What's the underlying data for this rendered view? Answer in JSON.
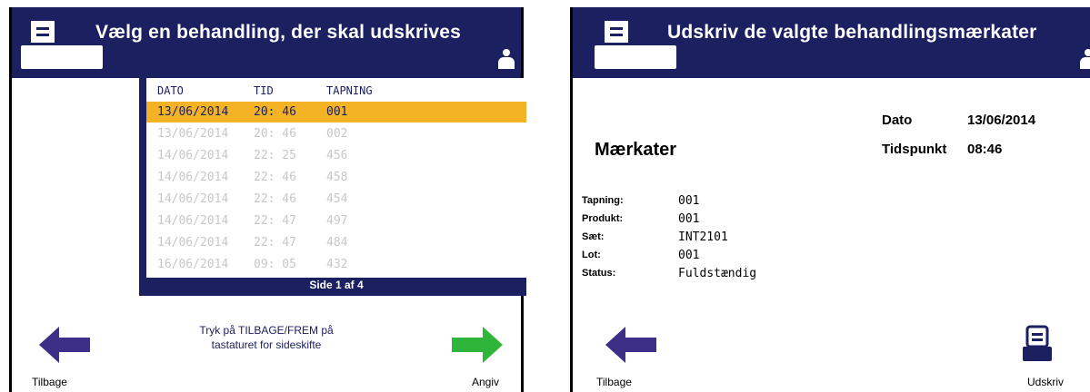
{
  "left": {
    "title": "Vælg en behandling, der skal udskrives",
    "columns": [
      "DATO",
      "TID",
      "TAPNING"
    ],
    "rows": [
      {
        "date": "13/06/2014",
        "time": "20: 46",
        "tap": "001",
        "selected": true
      },
      {
        "date": "13/06/2014",
        "time": "20: 46",
        "tap": "002",
        "selected": false
      },
      {
        "date": "14/06/2014",
        "time": "22: 25",
        "tap": "456",
        "selected": false
      },
      {
        "date": "14/06/2014",
        "time": "22: 46",
        "tap": "458",
        "selected": false
      },
      {
        "date": "14/06/2014",
        "time": "22: 46",
        "tap": "454",
        "selected": false
      },
      {
        "date": "14/06/2014",
        "time": "22: 47",
        "tap": "497",
        "selected": false
      },
      {
        "date": "14/06/2014",
        "time": "22: 47",
        "tap": "484",
        "selected": false
      },
      {
        "date": "16/06/2014",
        "time": "09: 05",
        "tap": "432",
        "selected": false
      }
    ],
    "page_indicator": "Side 1 af 4",
    "hint_line1": "Tryk på TILBAGE/FREM på",
    "hint_line2": "tastaturet for sideskifte",
    "back_label": "Tilbage",
    "enter_label": "Angiv"
  },
  "right": {
    "title": "Udskriv de valgte behandlingsmærkater",
    "date_label": "Dato",
    "date_value": "13/06/2014",
    "time_label": "Tidspunkt",
    "time_value": "08:46",
    "section_title": "Mærkater",
    "info": [
      {
        "key": "Tapning:",
        "value": "001"
      },
      {
        "key": "Produkt:",
        "value": "001"
      },
      {
        "key": "Sæt:",
        "value": "INT2101"
      },
      {
        "key": "Lot:",
        "value": "001"
      },
      {
        "key": "Status:",
        "value": "Fuldstændig"
      }
    ],
    "back_label": "Tilbage",
    "print_label": "Udskriv"
  },
  "colors": {
    "header": "#1b2060",
    "selected_row": "#f4b324",
    "back_arrow": "#3d2f88",
    "forward_arrow": "#2fb53a"
  },
  "icons": {
    "header_icon": "printer-icon",
    "user": "user-icon",
    "back": "left-arrow-icon",
    "forward": "right-arrow-icon",
    "print": "printer-icon"
  }
}
